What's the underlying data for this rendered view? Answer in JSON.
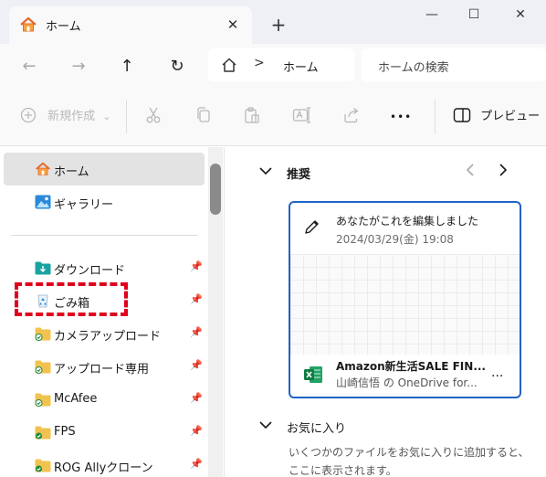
{
  "tab": {
    "title": "ホーム",
    "close": "✕",
    "new_tab": "+"
  },
  "window": {
    "minimize": "—",
    "maximize": "☐",
    "close": "✕"
  },
  "nav": {
    "back": "←",
    "forward": "→",
    "up": "↑",
    "refresh": "↻",
    "separator": ">"
  },
  "address": {
    "crumb": "ホーム"
  },
  "search": {
    "placeholder": "ホームの検索"
  },
  "command_bar": {
    "new_label": "新規作成",
    "new_caret": "⌄",
    "more": "•••",
    "preview_label": "プレビュー"
  },
  "sidebar": {
    "home": "ホーム",
    "gallery": "ギャラリー",
    "items": [
      {
        "label": "ダウンロード",
        "icon": "download-folder-icon"
      },
      {
        "label": "ごみ箱",
        "icon": "recycle-bin-icon"
      },
      {
        "label": "カメラアップロード",
        "icon": "folder-icon"
      },
      {
        "label": "アップロード専用",
        "icon": "folder-icon"
      },
      {
        "label": "McAfee",
        "icon": "folder-icon"
      },
      {
        "label": "FPS",
        "icon": "folder-icon"
      },
      {
        "label": "ROG Allyクローン",
        "icon": "folder-icon"
      }
    ]
  },
  "recommended": {
    "header": "推奨",
    "card": {
      "activity": "あなたがこれを編集しました",
      "date": "2024/03/29(金) 19:08",
      "file_name": "Amazon新生活SALE FIN...",
      "owner": "山崎信悟 の OneDrive for...",
      "more": "..."
    }
  },
  "favorites": {
    "header": "お気に入り",
    "hint": "いくつかのファイルをお気に入りに追加すると、ここに表示されます。"
  },
  "colors": {
    "accent": "#1f64c8",
    "highlight": "#e0001b",
    "folder": "#f2c24e"
  }
}
